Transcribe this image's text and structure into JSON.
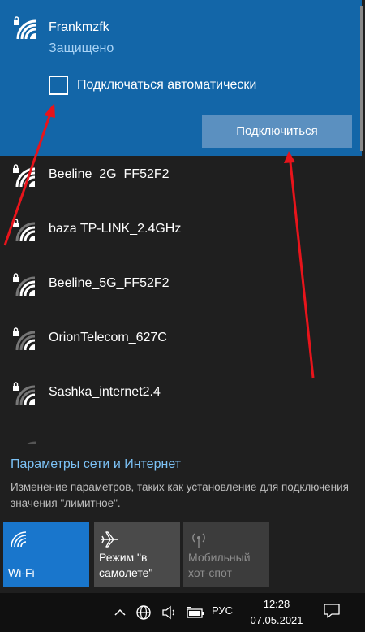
{
  "selected_network": {
    "name": "Frankmzfk",
    "status": "Защищено",
    "auto_connect_label": "Подключаться автоматически",
    "auto_connect_checked": false,
    "connect_button": "Подключиться",
    "icon": "wifi-secured-icon"
  },
  "networks": [
    {
      "name": "Beeline_2G_FF52F2",
      "icon": "wifi-secured-icon"
    },
    {
      "name": "baza TP-LINK_2.4GHz",
      "icon": "wifi-secured-icon"
    },
    {
      "name": "Beeline_5G_FF52F2",
      "icon": "wifi-secured-icon"
    },
    {
      "name": "OrionTelecom_627C",
      "icon": "wifi-secured-icon"
    },
    {
      "name": "Sashka_internet2.4",
      "icon": "wifi-secured-icon"
    }
  ],
  "settings": {
    "link": "Параметры сети и Интернет",
    "description": "Изменение параметров, таких как установление для подключения значения \"лимитное\"."
  },
  "tiles": [
    {
      "label": "Wi-Fi",
      "icon": "wifi-icon",
      "state": "on"
    },
    {
      "label": "Режим \"в самолете\"",
      "icon": "airplane-icon",
      "state": "off"
    },
    {
      "label": "Мобильный хот-спот",
      "icon": "hotspot-icon",
      "state": "disabled"
    }
  ],
  "taskbar": {
    "language": "РУС",
    "time": "12:28",
    "date": "07.05.2021",
    "icons": [
      "chevron-up-icon",
      "globe-network-icon",
      "volume-icon",
      "battery-icon",
      "notification-icon"
    ]
  },
  "colors": {
    "accent": "#1366a8",
    "tile_active": "#1976cc",
    "link": "#7cc2f6",
    "annotation_arrow": "#e8141b"
  }
}
